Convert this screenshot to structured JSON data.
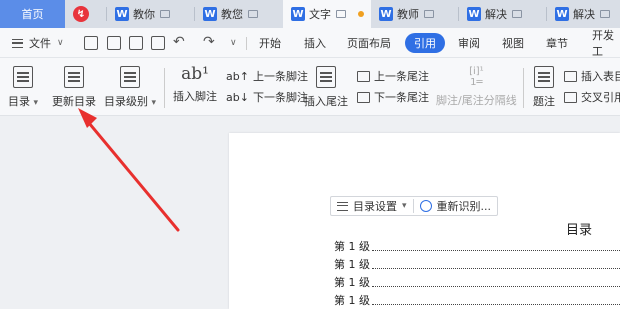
{
  "tabs": [
    {
      "label": "首页",
      "type": "home"
    },
    {
      "label": "",
      "type": "app-red"
    },
    {
      "label": "教你",
      "type": "doc"
    },
    {
      "label": "教您",
      "type": "doc"
    },
    {
      "label": "文字",
      "type": "doc-active"
    },
    {
      "label": "教师",
      "type": "doc"
    },
    {
      "label": "解决",
      "type": "doc"
    },
    {
      "label": "解决",
      "type": "doc"
    }
  ],
  "menubar": {
    "file_label": "文件",
    "tabs": [
      "开始",
      "插入",
      "页面布局",
      "引用",
      "审阅",
      "视图",
      "章节",
      "开发工"
    ],
    "active_tab": "引用"
  },
  "ribbon": {
    "toc": "目录",
    "update_toc": "更新目录",
    "toc_level": "目录级别",
    "insert_footnote": "插入脚注",
    "prev_footnote": "上一条脚注",
    "next_footnote": "下一条脚注",
    "insert_endnote": "插入尾注",
    "prev_endnote": "上一条尾注",
    "next_endnote": "下一条尾注",
    "footnote_separator": "脚注/尾注分隔线",
    "caption": "题注",
    "insert_table_of_figures": "插入表目",
    "cross_reference": "交叉引用"
  },
  "toc_toolbar": {
    "settings": "目录设置",
    "reidentify": "重新识别..."
  },
  "document": {
    "toc_title": "目录",
    "entries": [
      "第 1 级",
      "第 1 级",
      "第 1 级",
      "第 1 级"
    ]
  },
  "colors": {
    "accent": "#2f6fe4",
    "home_tab": "#5b8de8",
    "annotation_arrow": "#e8302e"
  }
}
